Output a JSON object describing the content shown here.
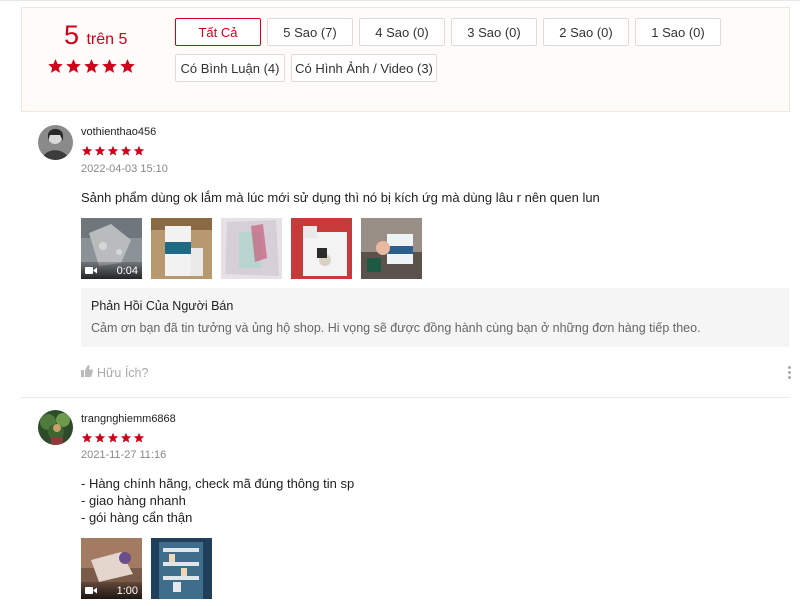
{
  "overview": {
    "score": "5",
    "of_label": "trên 5",
    "stars": 5,
    "filters": [
      {
        "label": "Tất Cả",
        "active": true
      },
      {
        "label": "5 Sao (7)",
        "active": false
      },
      {
        "label": "4 Sao (0)",
        "active": false
      },
      {
        "label": "3 Sao (0)",
        "active": false
      },
      {
        "label": "2 Sao (0)",
        "active": false
      },
      {
        "label": "1 Sao (0)",
        "active": false
      },
      {
        "label": "Có Bình Luận (4)",
        "active": false
      },
      {
        "label": "Có Hình Ảnh / Video (3)",
        "active": false
      }
    ]
  },
  "colors": {
    "accent": "#d0011b",
    "panel_bg": "#fffbf8"
  },
  "reviews": [
    {
      "username": "vothienthao456",
      "stars": 5,
      "date": "2022-04-03 15:10",
      "text_lines": [
        "Sảnh phẩm dùng ok lắm mà lúc mới sử dụng thì nó bị kích ứg mà dùng lâu r nên quen lun"
      ],
      "media": [
        {
          "type": "video",
          "duration": "0:04",
          "icon": "video-camera-icon"
        },
        {
          "type": "image"
        },
        {
          "type": "image"
        },
        {
          "type": "image"
        },
        {
          "type": "image"
        }
      ],
      "seller_reply": {
        "title": "Phản Hồi Của Người Bán",
        "message": "Cảm ơn bạn đã tin tưởng và ủng hộ shop. Hi vọng sẽ được đồng hành cùng bạn ở những đơn hàng tiếp theo."
      },
      "helpful_label": "Hữu Ích?"
    },
    {
      "username": "trangnghiemm6868",
      "stars": 5,
      "date": "2021-11-27 11:16",
      "text_lines": [
        "- Hàng chính hãng, check mã đúng thông tin sp",
        "- giao hàng nhanh",
        "- gói hàng cẩn thận"
      ],
      "media": [
        {
          "type": "video",
          "duration": "1:00",
          "icon": "video-camera-icon"
        },
        {
          "type": "image"
        }
      ]
    }
  ]
}
